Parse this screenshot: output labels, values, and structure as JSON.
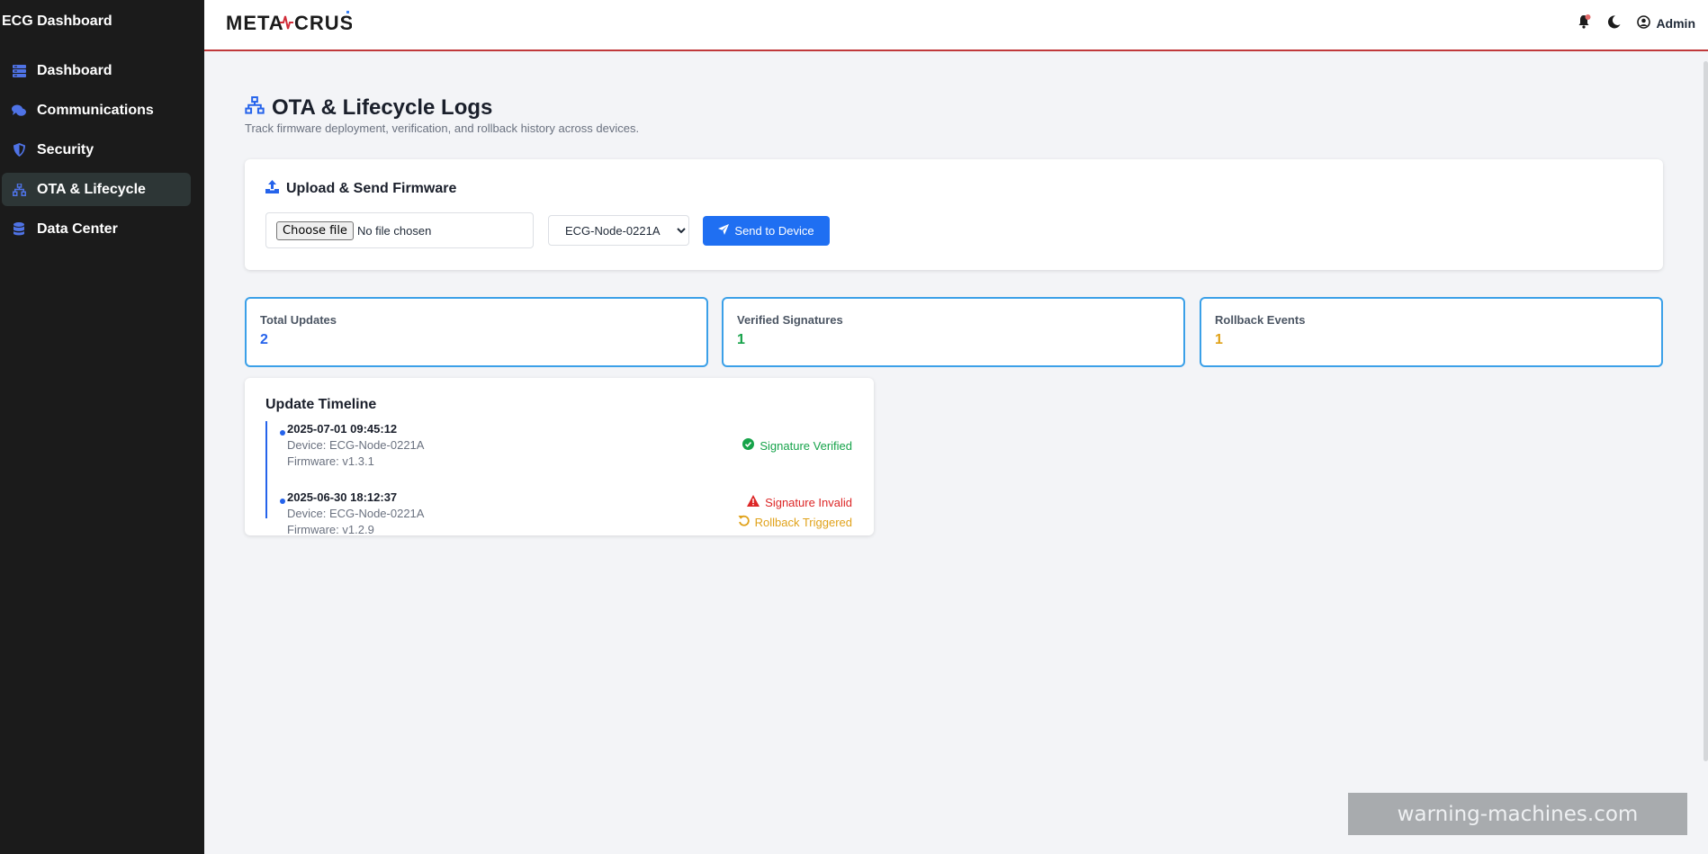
{
  "app": {
    "title": "ECG Dashboard"
  },
  "sidebar": {
    "items": [
      {
        "label": "Dashboard",
        "icon": "dashboard-icon"
      },
      {
        "label": "Communications",
        "icon": "comments-icon"
      },
      {
        "label": "Security",
        "icon": "shield-icon"
      },
      {
        "label": "OTA & Lifecycle",
        "icon": "network-icon",
        "active": true
      },
      {
        "label": "Data Center",
        "icon": "database-icon"
      }
    ]
  },
  "topbar": {
    "logo_text": "METACRUST",
    "user": "Admin"
  },
  "page": {
    "title": "OTA & Lifecycle Logs",
    "subtitle": "Track firmware deployment, verification, and rollback history across devices."
  },
  "upload": {
    "title": "Upload & Send Firmware",
    "choose_label": "Choose file",
    "file_status": "No file chosen",
    "device_selected": "ECG-Node-0221A",
    "send_label": "Send to Device"
  },
  "stats": [
    {
      "label": "Total Updates",
      "value": "2",
      "color": "#2563eb"
    },
    {
      "label": "Verified Signatures",
      "value": "1",
      "color": "#16a34a"
    },
    {
      "label": "Rollback Events",
      "value": "1",
      "color": "#e0a21a"
    }
  ],
  "timeline": {
    "title": "Update Timeline",
    "items": [
      {
        "time": "2025-07-01 09:45:12",
        "device": "Device: ECG-Node-0221A",
        "firmware": "Firmware: v1.3.1",
        "statuses": [
          {
            "label": "Signature Verified",
            "color": "#16a34a",
            "icon": "check-circle-icon"
          }
        ]
      },
      {
        "time": "2025-06-30 18:12:37",
        "device": "Device: ECG-Node-0221A",
        "firmware": "Firmware: v1.2.9",
        "statuses": [
          {
            "label": "Signature Invalid",
            "color": "#dc2626",
            "icon": "warning-icon"
          },
          {
            "label": "Rollback Triggered",
            "color": "#e0a21a",
            "icon": "rollback-icon"
          }
        ]
      }
    ]
  },
  "watermark": "warning-machines.com"
}
